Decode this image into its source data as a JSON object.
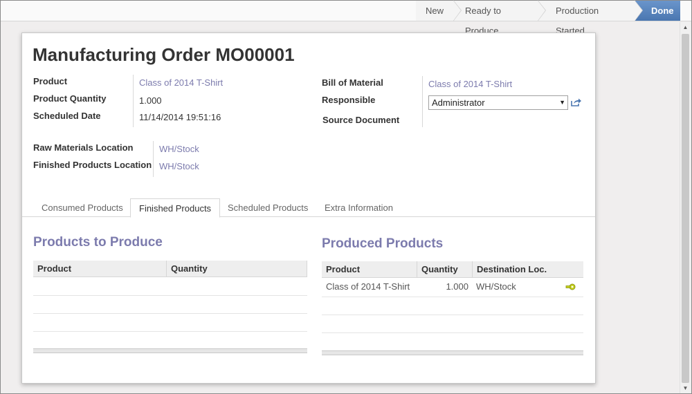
{
  "status": {
    "stages": [
      "New",
      "Ready to Produce",
      "Production Started",
      "Done"
    ]
  },
  "form": {
    "title": "Manufacturing Order",
    "reference": "MO00001",
    "left_fields": [
      {
        "label": "Product",
        "value": "Class of 2014 T-Shirt"
      },
      {
        "label": "Product Quantity",
        "value": "1.000"
      },
      {
        "label": "Scheduled Date",
        "value": "11/14/2014 19:51:16"
      }
    ],
    "right_fields": {
      "bom_label": "Bill of Material",
      "bom_value": "Class of 2014 T-Shirt",
      "responsible_label": "Responsible",
      "responsible_value": "Administrator",
      "source_label": "Source Document"
    },
    "locations": [
      {
        "label": "Raw Materials Location",
        "value": "WH/Stock"
      },
      {
        "label": "Finished Products Location",
        "value": "WH/Stock"
      }
    ]
  },
  "tabs": [
    "Consumed Products",
    "Finished Products",
    "Scheduled Products",
    "Extra Information"
  ],
  "to_produce": {
    "title": "Products to Produce",
    "columns": [
      "Product",
      "Quantity"
    ]
  },
  "produced": {
    "title": "Produced Products",
    "columns": [
      "Product",
      "Quantity",
      "Destination Loc."
    ],
    "rows": [
      {
        "product": "Class of 2014 T-Shirt",
        "quantity": "1.000",
        "location": "WH/Stock"
      }
    ]
  },
  "colors": {
    "link": "#7c7bad",
    "accent": "#4a76b0"
  }
}
